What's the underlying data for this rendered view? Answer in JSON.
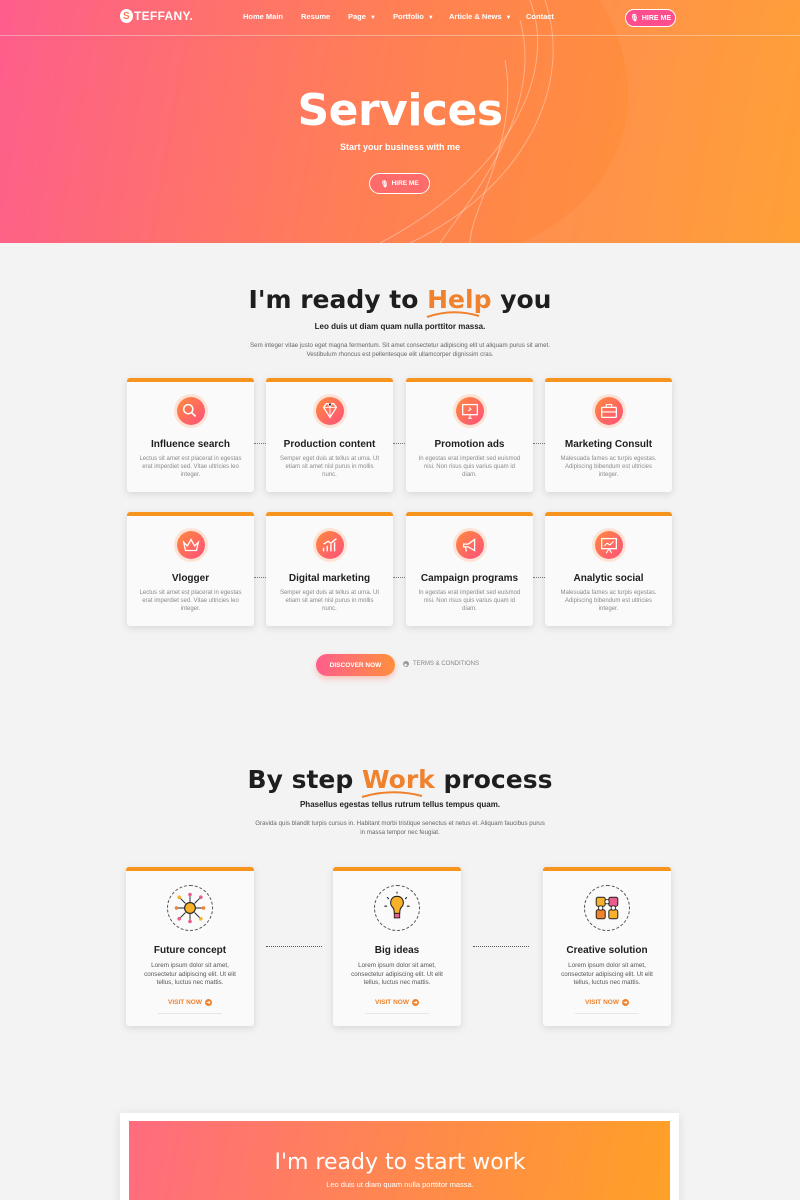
{
  "nav": {
    "logo_mark": "S",
    "logo_text": "TEFFANY.",
    "items": [
      {
        "label": "Home Main",
        "caret": false
      },
      {
        "label": "Resume",
        "caret": false
      },
      {
        "label": "Page",
        "caret": true
      },
      {
        "label": "Portfolio",
        "caret": true
      },
      {
        "label": "Article & News",
        "caret": true
      },
      {
        "label": "Contact",
        "caret": false
      }
    ],
    "hire_label": "HIRE ME"
  },
  "hero": {
    "title": "Services",
    "subtitle": "Start your business with me",
    "button_label": "HIRE ME"
  },
  "services": {
    "title_pre": "I'm ready to",
    "title_hl": "Help",
    "title_post": "you",
    "subtitle": "Leo duis ut diam quam nulla porttitor massa.",
    "description": "Sem integer vitae justo eget magna fermentum. Sit amet consectetur adipiscing elit ut aliquam purus sit amet. Vestibulum rhoncus est pellentesque elit ullamcorper dignissim cras.",
    "cards": [
      {
        "icon": "search-icon",
        "title": "Influence search",
        "desc": "Lectus sit amet est placerat in egestas erat imperdiet sed. Vitae ultricies leo integer."
      },
      {
        "icon": "diamond-icon",
        "title": "Production content",
        "desc": "Semper eget duis at tellus at urna. Ut etiam sit amet nisl purus in mollis nunc."
      },
      {
        "icon": "monitor-icon",
        "title": "Promotion ads",
        "desc": "In egestas erat imperdiet sed euismod nisi. Non risus quis varius quam id diam."
      },
      {
        "icon": "briefcase-icon",
        "title": "Marketing Consult",
        "desc": "Malesuada fames ac turpis egestas. Adipiscing bibendum est ultricies integer."
      },
      {
        "icon": "crown-icon",
        "title": "Vlogger",
        "desc": "Lectus sit amet est placerat in egestas erat imperdiet sed. Vitae ultricies leo integer."
      },
      {
        "icon": "growth-chart-icon",
        "title": "Digital marketing",
        "desc": "Semper eget duis at tellus at urna. Ut etiam sit amet nisl purus in mollis nunc."
      },
      {
        "icon": "megaphone-icon",
        "title": "Campaign programs",
        "desc": "In egestas erat imperdiet sed euismod nisi. Non risus quis varius quam id diam."
      },
      {
        "icon": "presentation-icon",
        "title": "Analytic social",
        "desc": "Malesuada fames ac turpis egestas. Adipiscing bibendum est ultricies integer."
      }
    ],
    "discover_label": "DISCOVER NOW",
    "terms_label": "TERMS & CONDITIONS"
  },
  "process": {
    "title_pre": "By step",
    "title_hl": "Work",
    "title_post": "process",
    "subtitle": "Phasellus egestas tellus rutrum tellus tempus quam.",
    "description": "Gravida quis blandit turpis cursus in. Habitant morbi tristique senectus et netus et. Aliquam faucibus purus in massa tempor nec feugiat.",
    "cards": [
      {
        "icon": "brain-network-icon",
        "title": "Future concept",
        "desc": "Lorem ipsum dolor sit amet, consectetur adipiscing elit. Ut elit tellus, luctus nec mattis.",
        "link": "VISIT NOW"
      },
      {
        "icon": "lightbulb-icon",
        "title": "Big ideas",
        "desc": "Lorem ipsum dolor sit amet, consectetur adipiscing elit. Ut elit tellus, luctus nec mattis.",
        "link": "VISIT NOW"
      },
      {
        "icon": "puzzle-icon",
        "title": "Creative solution",
        "desc": "Lorem ipsum dolor sit amet, consectetur adipiscing elit. Ut elit tellus, luctus nec mattis.",
        "link": "VISIT NOW"
      }
    ]
  },
  "cta": {
    "title": "I'm ready to start work",
    "subtitle": "Leo duis ut diam quam nulla porttitor massa."
  },
  "colors": {
    "accent": "#f0822e",
    "card_border": "#f7941d",
    "hero_start": "#fe5e8c",
    "hero_end": "#ff9a2a"
  }
}
